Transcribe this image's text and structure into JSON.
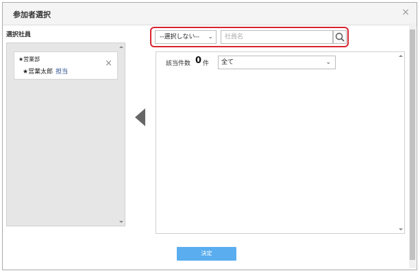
{
  "dialog": {
    "title": "参加者選択",
    "close_label": "×"
  },
  "selected": {
    "label": "選択社員",
    "items": [
      {
        "dept": "★営業部",
        "name": "★営業太郎",
        "role": "担当"
      }
    ],
    "remove_label": "×"
  },
  "search": {
    "dept_select_value": "--選択しない--",
    "name_placeholder": "社員名",
    "name_value": ""
  },
  "results": {
    "count_label": "該当件数",
    "count": "0",
    "count_unit": "件",
    "filter_value": "全て"
  },
  "footer": {
    "submit_label": "決定"
  },
  "colors": {
    "highlight": "#d9232e",
    "submit_bg": "#5aaef0",
    "role_text": "#2b4f8f"
  },
  "icons": {
    "search": "search-icon",
    "move_left": "arrow-left-icon",
    "close": "close-icon",
    "dropdown": "chevron-down-icon"
  }
}
